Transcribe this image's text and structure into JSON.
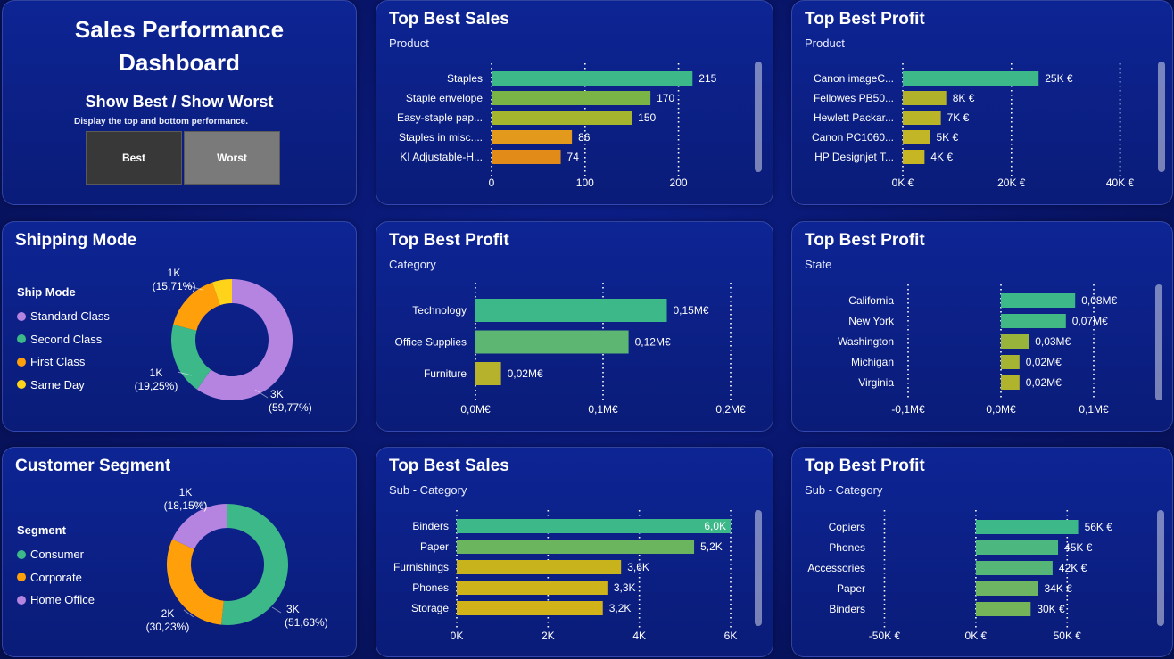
{
  "header": {
    "title": "Sales Performance Dashboard",
    "toggle_heading": "Show Best / Show Worst",
    "toggle_description": "Display the top and bottom performance.",
    "best_label": "Best",
    "worst_label": "Worst"
  },
  "shipping": {
    "title": "Shipping Mode",
    "legend_title": "Ship Mode",
    "legend": [
      {
        "label": "Standard Class",
        "color": "#b583e0"
      },
      {
        "label": "Second Class",
        "color": "#3db889"
      },
      {
        "label": "First Class",
        "color": "#ff9f0a"
      },
      {
        "label": "Same Day",
        "color": "#ffd31a"
      }
    ]
  },
  "segment": {
    "title": "Customer Segment",
    "legend_title": "Segment",
    "legend": [
      {
        "label": "Consumer",
        "color": "#3db889"
      },
      {
        "label": "Corporate",
        "color": "#ff9f0a"
      },
      {
        "label": "Home Office",
        "color": "#b583e0"
      }
    ]
  },
  "chart_data": [
    {
      "id": "sales_product",
      "type": "bar",
      "orientation": "horizontal",
      "title": "Top Best Sales",
      "subtitle": "Product",
      "categories": [
        "Staples",
        "Staple envelope",
        "Easy-staple pap...",
        "Staples in misc....",
        "KI Adjustable-H..."
      ],
      "values": [
        215,
        170,
        150,
        86,
        74
      ],
      "labels": [
        "215",
        "170",
        "150",
        "86",
        "74"
      ],
      "colors": [
        "#3db889",
        "#7ab446",
        "#a6b52e",
        "#e39a1c",
        "#e28b18"
      ],
      "xlim": [
        0,
        230
      ],
      "ticks": [
        0,
        100,
        200
      ],
      "tick_labels": [
        "0",
        "100",
        "200"
      ],
      "grid": true,
      "scrollbar": true
    },
    {
      "id": "profit_product",
      "type": "bar",
      "orientation": "horizontal",
      "title": "Top Best Profit",
      "subtitle": "Product",
      "categories": [
        "Canon imageC...",
        "Fellowes PB50...",
        "Hewlett Packar...",
        "Canon PC1060...",
        "HP Designjet T..."
      ],
      "values": [
        25000,
        8000,
        7000,
        5000,
        4000
      ],
      "labels": [
        "25K €",
        "8K €",
        "7K €",
        "5K €",
        "4K €"
      ],
      "colors": [
        "#3db889",
        "#b2b22a",
        "#b9b428",
        "#c2b526",
        "#c6b624"
      ],
      "xlim": [
        0,
        45000
      ],
      "ticks": [
        0,
        20000,
        40000
      ],
      "tick_labels": [
        "0K €",
        "20K €",
        "40K €"
      ],
      "grid": true,
      "scrollbar": true
    },
    {
      "id": "profit_category",
      "type": "bar",
      "orientation": "horizontal",
      "title": "Top Best Profit",
      "subtitle": "Category",
      "categories": [
        "Technology",
        "Office Supplies",
        "Furniture"
      ],
      "values": [
        0.15,
        0.12,
        0.02
      ],
      "labels": [
        "0,15M€",
        "0,12M€",
        "0,02M€"
      ],
      "colors": [
        "#3db889",
        "#5db672",
        "#b7b22c"
      ],
      "xlim": [
        0,
        0.2
      ],
      "ticks": [
        0,
        0.1,
        0.2
      ],
      "tick_labels": [
        "0,0M€",
        "0,1M€",
        "0,2M€"
      ],
      "grid": true,
      "scrollbar": false
    },
    {
      "id": "profit_state",
      "type": "bar",
      "orientation": "horizontal",
      "title": "Top Best Profit",
      "subtitle": "State",
      "categories": [
        "California",
        "New York",
        "Washington",
        "Michigan",
        "Virginia"
      ],
      "values": [
        0.08,
        0.07,
        0.03,
        0.02,
        0.02
      ],
      "labels": [
        "0,08M€",
        "0,07M€",
        "0,03M€",
        "0,02M€",
        "0,02M€"
      ],
      "colors": [
        "#3db889",
        "#42b985",
        "#99b43a",
        "#a5b432",
        "#b0b42c"
      ],
      "xlim": [
        -0.1,
        0.1
      ],
      "ticks": [
        -0.1,
        0,
        0.1
      ],
      "tick_labels": [
        "-0,1M€",
        "0,0M€",
        "0,1M€"
      ],
      "grid": true,
      "scrollbar": true
    },
    {
      "id": "sales_subcategory",
      "type": "bar",
      "orientation": "horizontal",
      "title": "Top Best Sales",
      "subtitle": "Sub - Category",
      "categories": [
        "Binders",
        "Paper",
        "Furnishings",
        "Phones",
        "Storage"
      ],
      "values": [
        6.0,
        5.2,
        3.6,
        3.3,
        3.2
      ],
      "labels": [
        "6,0K",
        "5,2K",
        "3,6K",
        "3,3K",
        "3,2K"
      ],
      "colors": [
        "#3db889",
        "#6bb55e",
        "#c8b31d",
        "#cfb31a",
        "#d1b319"
      ],
      "xlim": [
        0,
        6
      ],
      "ticks": [
        0,
        2,
        4,
        6
      ],
      "tick_labels": [
        "0K",
        "2K",
        "4K",
        "6K"
      ],
      "grid": true,
      "scrollbar": true
    },
    {
      "id": "profit_subcategory",
      "type": "bar",
      "orientation": "horizontal",
      "title": "Top Best Profit",
      "subtitle": "Sub - Category",
      "categories": [
        "Copiers",
        "Phones",
        "Accessories",
        "Paper",
        "Binders"
      ],
      "values": [
        56000,
        45000,
        42000,
        34000,
        30000
      ],
      "labels": [
        "56K €",
        "45K €",
        "42K €",
        "34K €",
        "30K €"
      ],
      "colors": [
        "#3db889",
        "#4cb77e",
        "#55b677",
        "#6db562",
        "#76b45a"
      ],
      "xlim": [
        -60000,
        65000
      ],
      "ticks": [
        -50000,
        0,
        50000
      ],
      "tick_labels": [
        "-50K €",
        "0K €",
        "50K €"
      ],
      "grid": true,
      "scrollbar": true
    },
    {
      "id": "shipping_donut",
      "type": "pie",
      "donut": true,
      "categories": [
        "Standard Class",
        "Second Class",
        "First Class",
        "Same Day"
      ],
      "values": [
        59.77,
        19.25,
        15.71,
        5.27
      ],
      "colors": [
        "#b583e0",
        "#3db889",
        "#ff9f0a",
        "#ffd31a"
      ],
      "labels": [
        {
          "value": "3K",
          "pct": "(59,77%)"
        },
        {
          "value": "1K",
          "pct": "(19,25%)"
        },
        {
          "value": "1K",
          "pct": "(15,71%)"
        }
      ]
    },
    {
      "id": "segment_donut",
      "type": "pie",
      "donut": true,
      "categories": [
        "Consumer",
        "Corporate",
        "Home Office"
      ],
      "values": [
        51.63,
        30.23,
        18.15
      ],
      "colors": [
        "#3db889",
        "#ff9f0a",
        "#b583e0"
      ],
      "labels": [
        {
          "value": "3K",
          "pct": "(51,63%)"
        },
        {
          "value": "2K",
          "pct": "(30,23%)"
        },
        {
          "value": "1K",
          "pct": "(18,15%)"
        }
      ]
    }
  ]
}
